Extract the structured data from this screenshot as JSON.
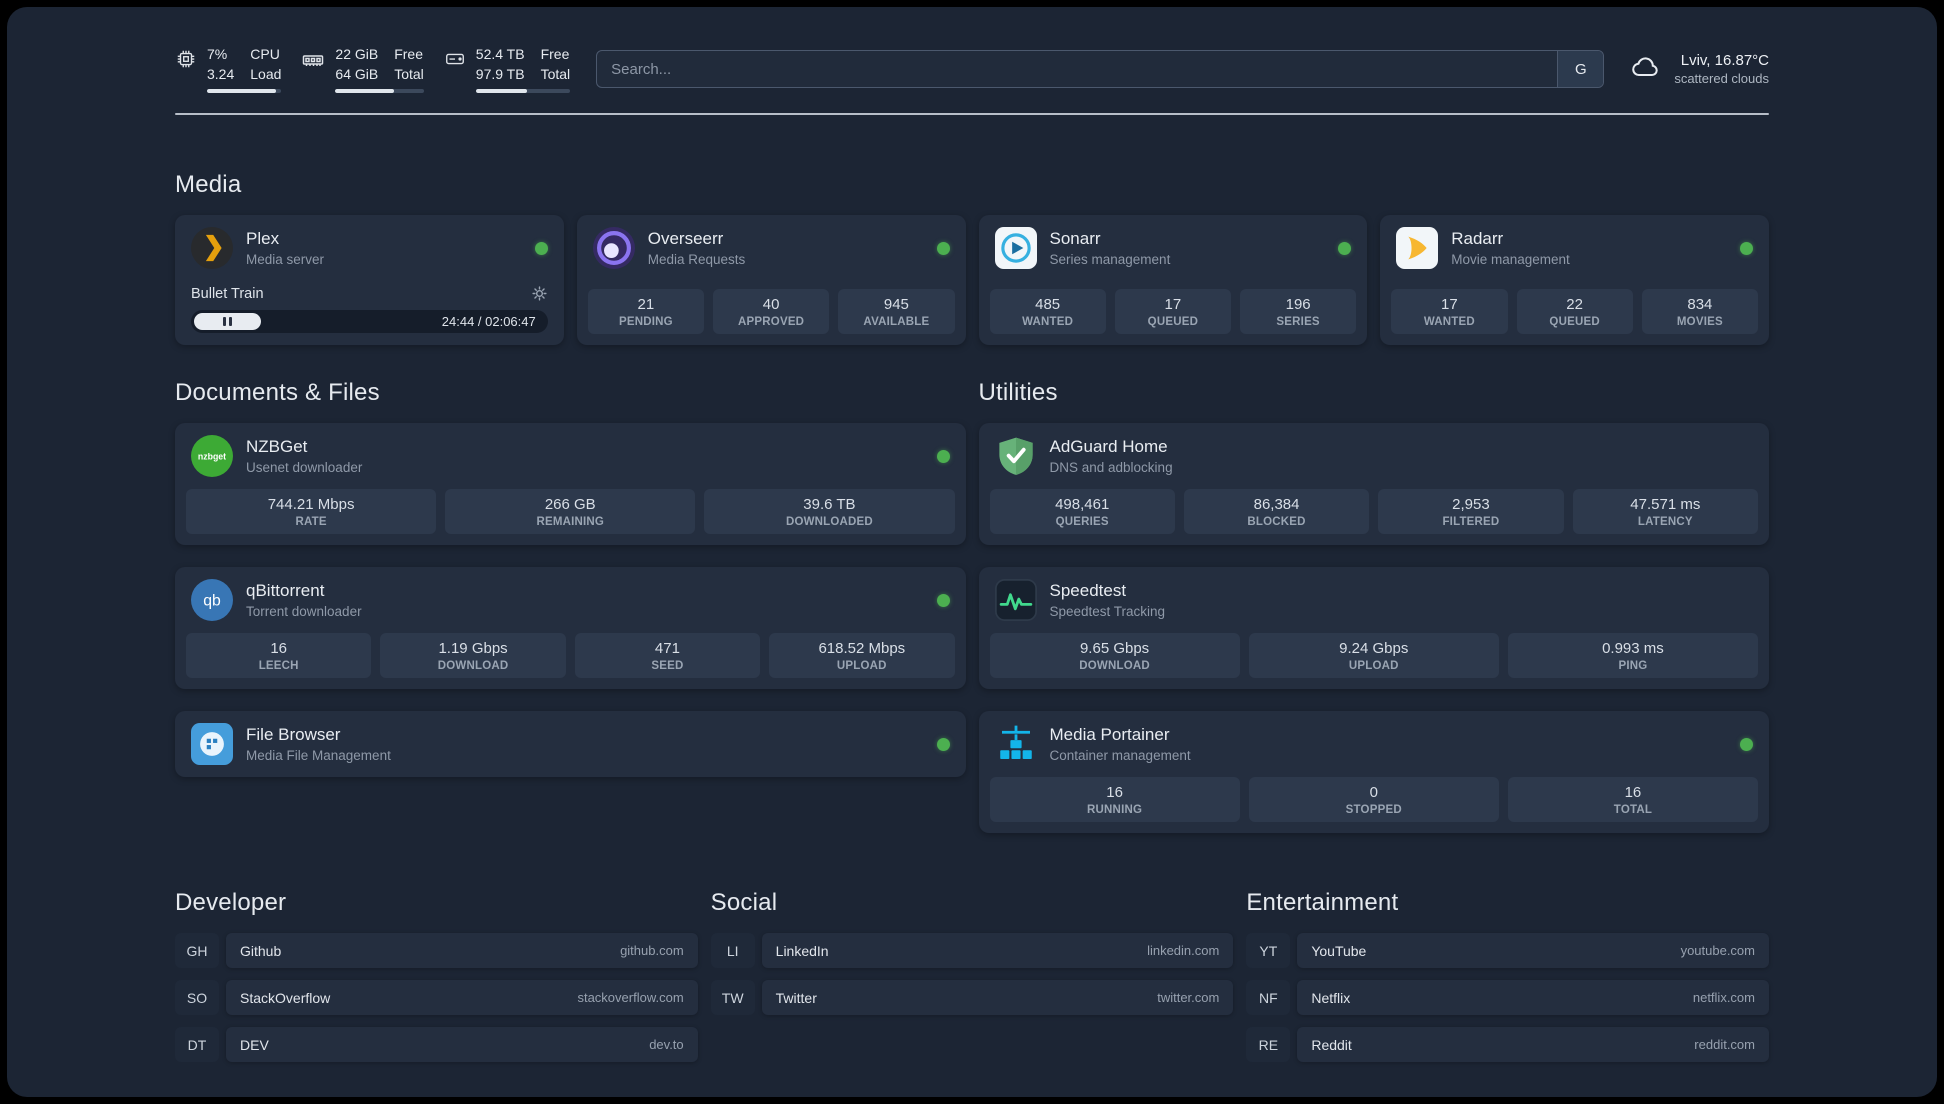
{
  "topbar": {
    "metrics": [
      {
        "icon": "cpu-icon",
        "values": [
          "7%",
          "3.24"
        ],
        "labels": [
          "CPU",
          "Load"
        ],
        "bar_pct": 93
      },
      {
        "icon": "ram-icon",
        "values": [
          "22 GiB",
          "64 GiB"
        ],
        "labels": [
          "Free",
          "Total"
        ],
        "bar_pct": 66
      },
      {
        "icon": "disk-icon",
        "values": [
          "52.4 TB",
          "97.9 TB"
        ],
        "labels": [
          "Free",
          "Total"
        ],
        "bar_pct": 54
      }
    ],
    "search": {
      "placeholder": "Search...",
      "provider_label": "G"
    },
    "weather": {
      "icon": "cloud-icon",
      "location": "Lviv, 16.87°C",
      "condition": "scattered clouds"
    }
  },
  "media": {
    "title": "Media",
    "cards": [
      {
        "icon": "plex-icon",
        "name": "Plex",
        "subtitle": "Media server",
        "online": true,
        "player": {
          "track": "Bullet Train",
          "time": "24:44 / 02:06:47",
          "progress_pct": 19
        }
      },
      {
        "icon": "overseerr-icon",
        "name": "Overseerr",
        "subtitle": "Media Requests",
        "online": true,
        "stats": [
          {
            "value": "21",
            "label": "PENDING"
          },
          {
            "value": "40",
            "label": "APPROVED"
          },
          {
            "value": "945",
            "label": "AVAILABLE"
          }
        ]
      },
      {
        "icon": "sonarr-icon",
        "name": "Sonarr",
        "subtitle": "Series management",
        "online": true,
        "stats": [
          {
            "value": "485",
            "label": "WANTED"
          },
          {
            "value": "17",
            "label": "QUEUED"
          },
          {
            "value": "196",
            "label": "SERIES"
          }
        ]
      },
      {
        "icon": "radarr-icon",
        "name": "Radarr",
        "subtitle": "Movie management",
        "online": true,
        "stats": [
          {
            "value": "17",
            "label": "WANTED"
          },
          {
            "value": "22",
            "label": "QUEUED"
          },
          {
            "value": "834",
            "label": "MOVIES"
          }
        ]
      }
    ]
  },
  "documents": {
    "title": "Documents & Files",
    "cards": [
      {
        "icon": "nzbget-icon",
        "name": "NZBGet",
        "subtitle": "Usenet downloader",
        "online": true,
        "stats": [
          {
            "value": "744.21 Mbps",
            "label": "RATE"
          },
          {
            "value": "266 GB",
            "label": "REMAINING"
          },
          {
            "value": "39.6 TB",
            "label": "DOWNLOADED"
          }
        ]
      },
      {
        "icon": "qbittorrent-icon",
        "name": "qBittorrent",
        "subtitle": "Torrent downloader",
        "online": true,
        "stats": [
          {
            "value": "16",
            "label": "LEECH"
          },
          {
            "value": "1.19 Gbps",
            "label": "DOWNLOAD"
          },
          {
            "value": "471",
            "label": "SEED"
          },
          {
            "value": "618.52 Mbps",
            "label": "UPLOAD"
          }
        ]
      },
      {
        "icon": "filebrowser-icon",
        "name": "File Browser",
        "subtitle": "Media File Management",
        "online": true
      }
    ]
  },
  "utilities": {
    "title": "Utilities",
    "cards": [
      {
        "icon": "adguard-icon",
        "name": "AdGuard Home",
        "subtitle": "DNS and adblocking",
        "stats": [
          {
            "value": "498,461",
            "label": "QUERIES"
          },
          {
            "value": "86,384",
            "label": "BLOCKED"
          },
          {
            "value": "2,953",
            "label": "FILTERED"
          },
          {
            "value": "47.571 ms",
            "label": "LATENCY"
          }
        ]
      },
      {
        "icon": "speedtest-icon",
        "name": "Speedtest",
        "subtitle": "Speedtest Tracking",
        "stats": [
          {
            "value": "9.65 Gbps",
            "label": "DOWNLOAD"
          },
          {
            "value": "9.24 Gbps",
            "label": "UPLOAD"
          },
          {
            "value": "0.993 ms",
            "label": "PING"
          }
        ]
      },
      {
        "icon": "portainer-icon",
        "name": "Media Portainer",
        "subtitle": "Container management",
        "online": true,
        "stats": [
          {
            "value": "16",
            "label": "RUNNING"
          },
          {
            "value": "0",
            "label": "STOPPED"
          },
          {
            "value": "16",
            "label": "TOTAL"
          }
        ]
      }
    ]
  },
  "links": {
    "groups": [
      {
        "title": "Developer",
        "items": [
          {
            "abbr": "GH",
            "name": "Github",
            "url": "github.com"
          },
          {
            "abbr": "SO",
            "name": "StackOverflow",
            "url": "stackoverflow.com"
          },
          {
            "abbr": "DT",
            "name": "DEV",
            "url": "dev.to"
          }
        ]
      },
      {
        "title": "Social",
        "items": [
          {
            "abbr": "LI",
            "name": "LinkedIn",
            "url": "linkedin.com"
          },
          {
            "abbr": "TW",
            "name": "Twitter",
            "url": "twitter.com"
          }
        ]
      },
      {
        "title": "Entertainment",
        "items": [
          {
            "abbr": "YT",
            "name": "YouTube",
            "url": "youtube.com"
          },
          {
            "abbr": "NF",
            "name": "Netflix",
            "url": "netflix.com"
          },
          {
            "abbr": "RE",
            "name": "Reddit",
            "url": "reddit.com"
          }
        ]
      }
    ]
  },
  "colors": {
    "status_online": "#4caf50",
    "background": "#1c2534",
    "card": "#242e3f",
    "stat_box": "#2d394c"
  }
}
